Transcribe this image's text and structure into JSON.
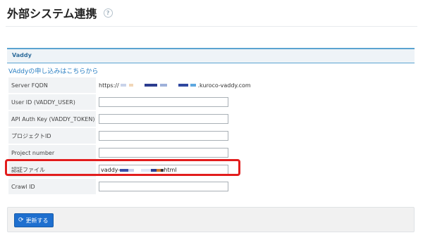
{
  "header": {
    "title": "外部システム連携",
    "help_icon": "question-circle-icon",
    "help_glyph": "?"
  },
  "section": {
    "title": "Vaddy",
    "apply_link": "VAddyの申し込みはこちらから"
  },
  "fields": [
    {
      "label": "Server FQDN",
      "value_prefix": "https://",
      "value_suffix": ".kuroco-vaddy.com"
    },
    {
      "label": "User ID (VADDY_USER)",
      "value": ""
    },
    {
      "label": "API Auth Key (VADDY_TOKEN)",
      "value": ""
    },
    {
      "label": "プロジェクトID",
      "value": ""
    },
    {
      "label": "Project number",
      "value": ""
    },
    {
      "label": "認証ファイル",
      "value_prefix": "vaddy-",
      "value_suffix": "html"
    },
    {
      "label": "Crawl ID",
      "value": ""
    }
  ],
  "footer": {
    "update_label": "更新する",
    "update_icon": "sync-icon",
    "update_glyph": "⟳"
  },
  "colors": {
    "accent": "#1e6fcf",
    "link": "#2a7fc3",
    "section_rule": "#5aa3d1",
    "highlight": "#e21d1d"
  }
}
